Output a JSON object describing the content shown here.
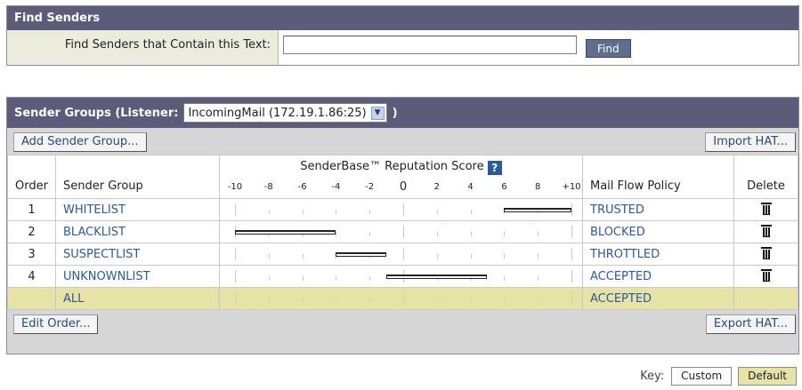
{
  "find_senders": {
    "title": "Find Senders",
    "label": "Find Senders that Contain this Text:",
    "input_value": "",
    "button": "Find"
  },
  "sender_groups": {
    "title_prefix": "Sender Groups (Listener:",
    "listener": "IncomingMail (172.19.1.86:25)",
    "title_suffix": ")",
    "add_button": "Add Sender Group...",
    "import_button": "Import HAT...",
    "edit_order_button": "Edit Order...",
    "export_button": "Export HAT...",
    "columns": {
      "order": "Order",
      "group": "Sender Group",
      "score": "SenderBase™ Reputation Score",
      "help": "?",
      "policy": "Mail Flow Policy",
      "delete": "Delete"
    },
    "score_ticks": [
      "-10",
      "-8",
      "-6",
      "-4",
      "-2",
      "0",
      "2",
      "4",
      "6",
      "8",
      "+10"
    ],
    "rows": [
      {
        "order": "1",
        "group": "WHITELIST",
        "score_min": 6.0,
        "score_max": 10.0,
        "policy": "TRUSTED",
        "deletable": true
      },
      {
        "order": "2",
        "group": "BLACKLIST",
        "score_min": -10.0,
        "score_max": -4.0,
        "policy": "BLOCKED",
        "deletable": true
      },
      {
        "order": "3",
        "group": "SUSPECTLIST",
        "score_min": -4.0,
        "score_max": -1.0,
        "policy": "THROTTLED",
        "deletable": true
      },
      {
        "order": "4",
        "group": "UNKNOWNLIST",
        "score_min": -1.0,
        "score_max": 5.0,
        "policy": "ACCEPTED",
        "deletable": true
      },
      {
        "order": "",
        "group": "ALL",
        "score_min": null,
        "score_max": null,
        "policy": "ACCEPTED",
        "deletable": false
      }
    ]
  },
  "key": {
    "label": "Key:",
    "custom": "Custom",
    "default": "Default"
  },
  "colors": {
    "header_bg": "#5b5b7a",
    "default_row": "#e7e3a6",
    "link": "#2b5a9a"
  }
}
